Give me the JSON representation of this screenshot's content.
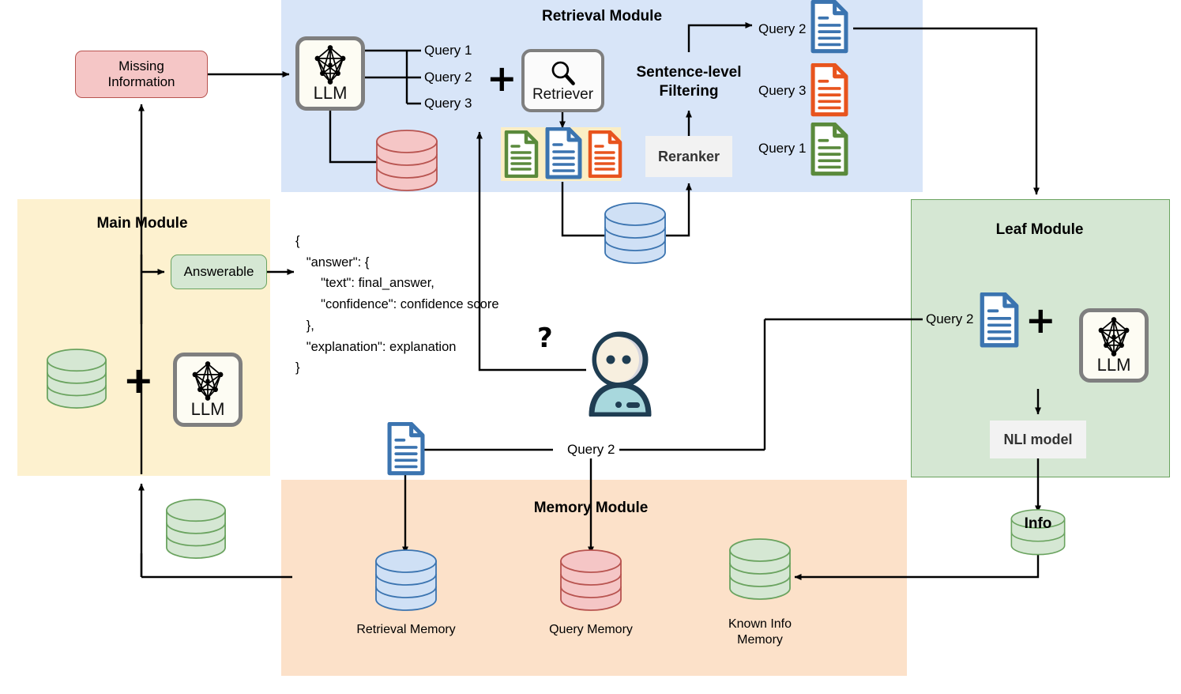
{
  "modules": {
    "retrieval": {
      "title": "Retrieval Module"
    },
    "main": {
      "title": "Main Module"
    },
    "leaf": {
      "title": "Leaf Module"
    },
    "memory": {
      "title": "Memory Module"
    }
  },
  "boxes": {
    "missing_information": "Missing\nInformation",
    "answerable": "Answerable",
    "reranker": "Reranker",
    "nli_model": "NLI model",
    "retriever": "Retriever",
    "sentence_level_filtering": "Sentence-level\nFiltering"
  },
  "llm_label": "LLM",
  "plus_symbol": "+",
  "question_mark": "?",
  "retrieval": {
    "generated_queries": [
      "Query 1",
      "Query 2",
      "Query 3"
    ],
    "ranked_results": [
      {
        "label": "Query 2",
        "color": "#3b74b0"
      },
      {
        "label": "Query 3",
        "color": "#e8541e"
      },
      {
        "label": "Query 1",
        "color": "#5a8a3c"
      }
    ],
    "retrieved_docs": [
      "#5a8a3c",
      "#3b74b0",
      "#e8541e"
    ]
  },
  "leaf": {
    "query_label": "Query 2",
    "output_db_label": "Info"
  },
  "memory": {
    "stores": [
      {
        "label": "Retrieval Memory",
        "color": "#3b74b0",
        "fill": "#cfe0f5"
      },
      {
        "label": "Query Memory",
        "color": "#b85450",
        "fill": "#f5c6c6"
      },
      {
        "label": "Known Info\nMemory",
        "color": "#6aa35f",
        "fill": "#d5e7d3"
      }
    ]
  },
  "edge_labels": {
    "query2_to_memory": "Query 2"
  },
  "json_output": "{\n   \"answer\": {\n       \"text\": final_answer,\n       \"confidence\": confidence score\n   },\n   \"explanation\": explanation\n}",
  "colors": {
    "retrieval_module_bg": "#d8e5f8",
    "main_module_bg": "#fdf1cf",
    "leaf_module_bg": "#d5e7d3",
    "memory_module_bg": "#fce1c9",
    "missing_info_bg": "#f5c6c6",
    "missing_info_border": "#b85450",
    "answerable_bg": "#d5e7d3",
    "answerable_border": "#6aa35f",
    "doc_blue": "#3b74b0",
    "doc_orange": "#e8541e",
    "doc_green": "#5a8a3c",
    "db_pink_fill": "#f5c6c6",
    "db_pink_stroke": "#b85450",
    "db_blue_fill": "#cfe0f5",
    "db_blue_stroke": "#3b74b0",
    "db_green_fill": "#d5e7d3",
    "db_green_stroke": "#6aa35f",
    "connector": "#000000",
    "avatar_dark": "#1f3d52",
    "avatar_face": "#f7efdf",
    "avatar_body": "#a8d8dd"
  }
}
